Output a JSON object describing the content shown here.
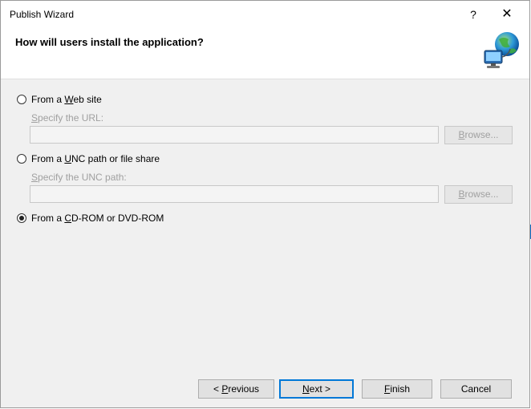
{
  "window": {
    "title": "Publish Wizard",
    "help_glyph": "?",
    "close_glyph": "✕"
  },
  "header": {
    "question": "How will users install the application?",
    "icon": "globe-computer-icon"
  },
  "options": [
    {
      "label_pre": "From a ",
      "label_mnemonic": "W",
      "label_post": "eb site",
      "checked": false,
      "sublabel_mnemonic": "S",
      "sublabel_rest": "pecify the URL:",
      "value": "",
      "browse_mnemonic": "B",
      "browse_rest": "rowse..."
    },
    {
      "label_pre": "From a ",
      "label_mnemonic": "U",
      "label_post": "NC path or file share",
      "checked": false,
      "sublabel_mnemonic": "S",
      "sublabel_rest": "pecify the UNC path:",
      "value": "",
      "browse_mnemonic": "B",
      "browse_rest": "rowse..."
    },
    {
      "label_pre": "From a ",
      "label_mnemonic": "C",
      "label_post": "D-ROM or DVD-ROM",
      "checked": true
    }
  ],
  "footer": {
    "previous_pre": "< ",
    "previous_mnemonic": "P",
    "previous_post": "revious",
    "next_mnemonic": "N",
    "next_post": "ext >",
    "finish_mnemonic": "F",
    "finish_post": "inish",
    "cancel": "Cancel"
  },
  "colors": {
    "accent": "#0078d7",
    "dialog_bg": "#f0f0f0"
  }
}
